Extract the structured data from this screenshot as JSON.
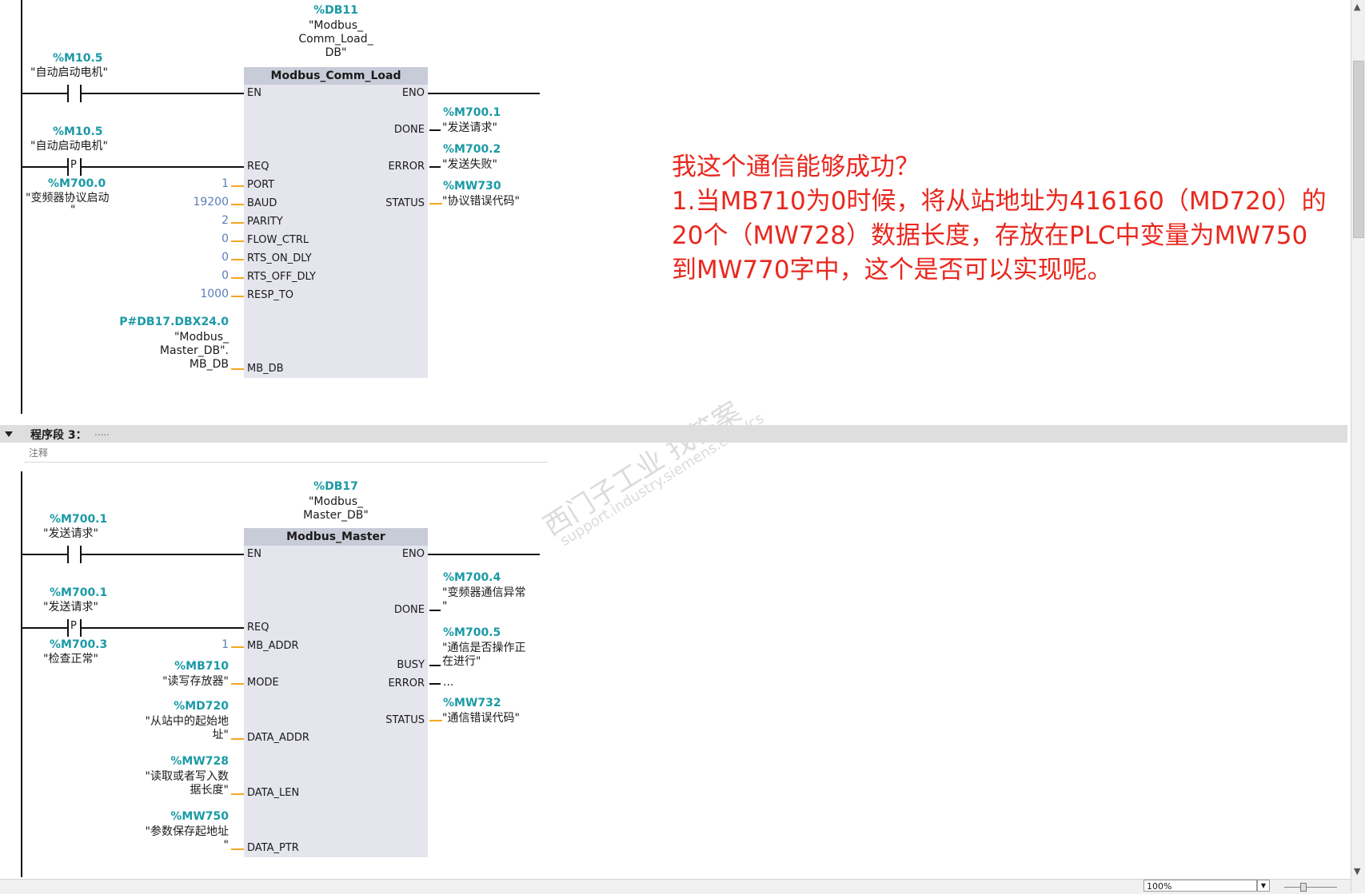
{
  "net2": {
    "instance_tag": "%DB11",
    "instance_name_lines": [
      "\"Modbus_",
      "Comm_Load_",
      "DB\""
    ],
    "fb_title": "Modbus_Comm_Load",
    "contact1_tag": "%M10.5",
    "contact1_name": "\"自动启动电机\"",
    "contact2_tag": "%M10.5",
    "contact2_name": "\"自动启动电机\"",
    "edge_label": "P",
    "edge_tag": "%M700.0",
    "edge_name_lines": [
      "\"变频器协议启动",
      "\""
    ],
    "inputs": [
      "EN",
      "REQ",
      "PORT",
      "BAUD",
      "PARITY",
      "FLOW_CTRL",
      "RTS_ON_DLY",
      "RTS_OFF_DLY",
      "RESP_TO",
      "MB_DB"
    ],
    "input_values": {
      "PORT": "1",
      "BAUD": "19200",
      "PARITY": "2",
      "FLOW_CTRL": "0",
      "RTS_ON_DLY": "0",
      "RTS_OFF_DLY": "0",
      "RESP_TO": "1000"
    },
    "mbdb_tag": "P#DB17.DBX24.0",
    "mbdb_name_lines": [
      "\"Modbus_",
      "Master_DB\".",
      "MB_DB"
    ],
    "outputs": [
      "ENO",
      "DONE",
      "ERROR",
      "STATUS"
    ],
    "done_tag": "%M700.1",
    "done_name": "\"发送请求\"",
    "error_tag": "%M700.2",
    "error_name": "\"发送失败\"",
    "status_tag": "%MW730",
    "status_name": "\"协议错误代码\""
  },
  "question_lines": [
    "我这个通信能够成功？",
    "1.当MB710为0时候，将从站地址为416160（MD720）的",
    "20个（MW728）数据长度，存放在PLC中变量为MW750",
    "到MW770字中，这个是否可以实现呢。"
  ],
  "segment3": {
    "label": "程序段 3：",
    "dots": ".....",
    "comment": "注释"
  },
  "net3": {
    "instance_tag": "%DB17",
    "instance_name_lines": [
      "\"Modbus_",
      "Master_DB\""
    ],
    "fb_title": "Modbus_Master",
    "contact1_tag": "%M700.1",
    "contact1_name": "\"发送请求\"",
    "contact2_tag": "%M700.1",
    "contact2_name": "\"发送请求\"",
    "edge_label": "P",
    "edge_tag": "%M700.3",
    "edge_name": "\"检查正常\"",
    "inputs": [
      "EN",
      "REQ",
      "MB_ADDR",
      "MODE",
      "DATA_ADDR",
      "DATA_LEN",
      "DATA_PTR"
    ],
    "mb_addr_value": "1",
    "mode_tag": "%MB710",
    "mode_name": "\"读写存放器\"",
    "data_addr_tag": "%MD720",
    "data_addr_name_lines": [
      "\"从站中的起始地",
      "址\""
    ],
    "data_len_tag": "%MW728",
    "data_len_name_lines": [
      "\"读取或者写入数",
      "据长度\""
    ],
    "data_ptr_tag": "%MW750",
    "data_ptr_name_lines": [
      "\"参数保存起地址",
      "\""
    ],
    "outputs": [
      "ENO",
      "DONE",
      "BUSY",
      "ERROR",
      "STATUS"
    ],
    "done_tag": "%M700.4",
    "done_name_lines": [
      "\"变频器通信异常",
      "\""
    ],
    "busy_tag": "%M700.5",
    "busy_name_lines": [
      "\"通信是否操作正",
      "在进行\""
    ],
    "error_value": "...",
    "status_tag": "%MW732",
    "status_name": "\"通信错误代码\""
  },
  "statusbar": {
    "zoom": "100%"
  },
  "watermark": {
    "line1": "西门子工业  找答案",
    "line2": "support.industry.siemens.com/cs"
  },
  "colors": {
    "tag": "#1b9aa6",
    "question": "#e8281e",
    "pin_wire": "#f5a623",
    "fb_body": "#e4e5ed",
    "fb_header": "#c8ccd8"
  }
}
